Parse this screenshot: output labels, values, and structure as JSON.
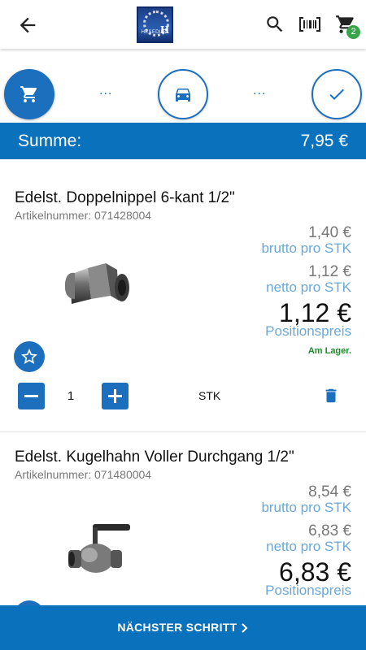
{
  "header": {
    "logo_text": "HESEDING",
    "logo_letter": "H",
    "cart_count": "2"
  },
  "stepper": {
    "dots": "..."
  },
  "summary": {
    "label": "Summe:",
    "value": "7,95 €"
  },
  "items": [
    {
      "name": "Edelst. Doppelnippel 6-kant 1/2\"",
      "article": "Artikelnummer: 071428004",
      "gross_price": "1,40 €",
      "gross_label": "brutto pro STK",
      "net_price": "1,12 €",
      "net_label": "netto pro STK",
      "position_price": "1,12 €",
      "position_label": "Positionspreis",
      "stock": "Am Lager.",
      "quantity": "1",
      "unit": "STK"
    },
    {
      "name": "Edelst. Kugelhahn Voller Durchgang 1/2\"",
      "article": "Artikelnummer: 071480004",
      "gross_price": "8,54 €",
      "gross_label": "brutto pro STK",
      "net_price": "6,83 €",
      "net_label": "netto pro STK",
      "position_price": "6,83 €",
      "position_label": "Positionspreis"
    }
  ],
  "footer": {
    "next_label": "NÄCHSTER SCHRITT"
  }
}
